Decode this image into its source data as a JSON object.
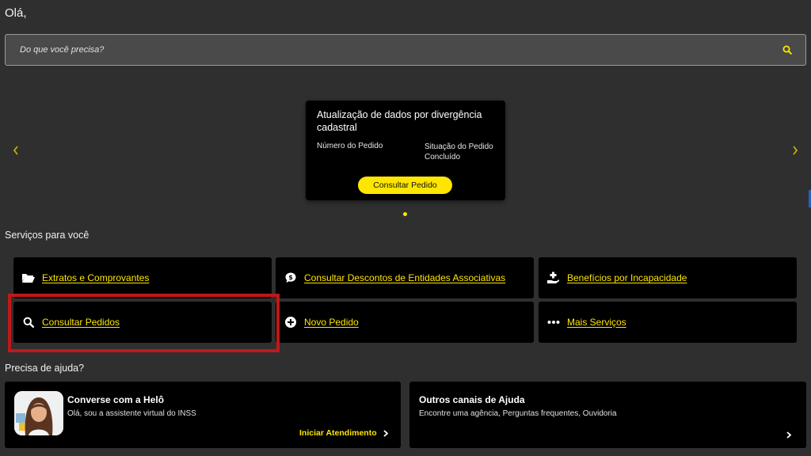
{
  "greeting": "Olá,",
  "search": {
    "placeholder": "Do que você precisa?"
  },
  "carousel": {
    "card": {
      "title": "Atualização de dados por divergência cadastral",
      "col1_label": "Número do Pedido",
      "col2_label": "Situação do Pedido",
      "col2_value": "Concluído",
      "button_label": "Consultar Pedido"
    }
  },
  "services": {
    "title": "Serviços para você",
    "items": [
      {
        "label": "Extratos e Comprovantes",
        "icon": "folder-open-icon"
      },
      {
        "label": "Consultar Descontos de Entidades Associativas",
        "icon": "comment-dollar-icon"
      },
      {
        "label": "Benefícios por Incapacidade",
        "icon": "hand-medical-icon"
      },
      {
        "label": "Consultar Pedidos",
        "icon": "search-icon"
      },
      {
        "label": "Novo Pedido",
        "icon": "plus-circle-icon"
      },
      {
        "label": "Mais Serviços",
        "icon": "ellipsis-icon"
      }
    ]
  },
  "help": {
    "title": "Precisa de ajuda?",
    "helo": {
      "title": "Converse com a Helô",
      "subtitle": "Olá, sou a assistente virtual do INSS",
      "link": "Iniciar Atendimento"
    },
    "other": {
      "title": "Outros canais de Ajuda",
      "subtitle": "Encontre uma agência, Perguntas frequentes, Ouvidoria"
    }
  },
  "colors": {
    "accent": "#ffe600",
    "background": "#2f2f2f",
    "card": "#000000",
    "highlight": "#c01818"
  }
}
